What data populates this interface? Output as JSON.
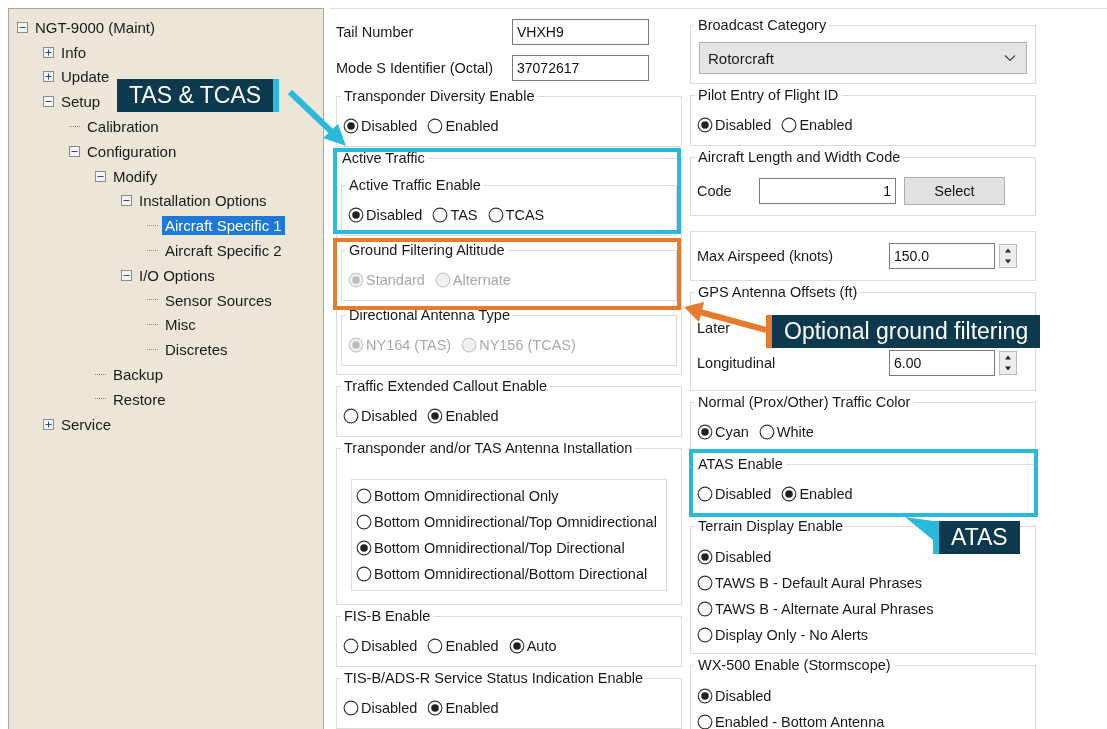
{
  "tree": [
    {
      "label": "NGT-9000 (Maint)",
      "expanded": true,
      "selected": false,
      "children": [
        {
          "label": "Info",
          "expanded": false,
          "selected": false
        },
        {
          "label": "Update",
          "expanded": false,
          "selected": false
        },
        {
          "label": "Setup",
          "expanded": true,
          "selected": false,
          "children": [
            {
              "label": "Calibration",
              "selected": false
            },
            {
              "label": "Configuration",
              "expanded": true,
              "selected": false,
              "children": [
                {
                  "label": "Modify",
                  "expanded": true,
                  "selected": false,
                  "children": [
                    {
                      "label": "Installation Options",
                      "expanded": true,
                      "selected": false,
                      "children": [
                        {
                          "label": "Aircraft Specific 1",
                          "selected": true
                        },
                        {
                          "label": "Aircraft Specific 2",
                          "selected": false
                        }
                      ]
                    },
                    {
                      "label": "I/O Options",
                      "expanded": true,
                      "selected": false,
                      "children": [
                        {
                          "label": "Sensor Sources",
                          "selected": false
                        },
                        {
                          "label": "Misc",
                          "selected": false
                        },
                        {
                          "label": "Discretes",
                          "selected": false
                        }
                      ]
                    }
                  ]
                },
                {
                  "label": "Backup",
                  "selected": false
                },
                {
                  "label": "Restore",
                  "selected": false
                }
              ]
            }
          ]
        },
        {
          "label": "Service",
          "expanded": false,
          "selected": false
        }
      ]
    }
  ],
  "column_1": [
    {
      "kind": "field",
      "label": "Tail Number",
      "value": "VHXH9"
    },
    {
      "kind": "field",
      "label": "Mode S Identifier (Octal)",
      "value": "37072617"
    },
    {
      "kind": "radio",
      "title": "Transponder Diversity Enable",
      "disabled": false,
      "options": [
        {
          "label": "Disabled",
          "selected": true
        },
        {
          "label": "Enabled",
          "selected": false
        }
      ]
    },
    {
      "kind": "section",
      "title": "Active Traffic",
      "groups": [
        {
          "kind": "radio",
          "title": "Active Traffic Enable",
          "disabled": false,
          "options": [
            {
              "label": "Disabled",
              "selected": true
            },
            {
              "label": "TAS",
              "selected": false
            },
            {
              "label": "TCAS",
              "selected": false
            }
          ]
        },
        {
          "kind": "radio",
          "title": "Ground Filtering Altitude",
          "disabled": true,
          "options": [
            {
              "label": "Standard",
              "selected": true
            },
            {
              "label": "Alternate",
              "selected": false
            }
          ]
        },
        {
          "kind": "radio",
          "title": "Directional Antenna Type",
          "disabled": true,
          "options": [
            {
              "label": "NY164 (TAS)",
              "selected": true
            },
            {
              "label": "NY156 (TCAS)",
              "selected": false
            }
          ]
        }
      ]
    },
    {
      "kind": "radio",
      "title": "Traffic Extended Callout Enable",
      "disabled": false,
      "options": [
        {
          "label": "Disabled",
          "selected": false
        },
        {
          "label": "Enabled",
          "selected": true
        }
      ]
    },
    {
      "kind": "radio_box",
      "title": "Transponder and/or TAS Antenna Installation",
      "disabled": false,
      "options": [
        {
          "label": "Bottom Omnidirectional Only",
          "selected": false
        },
        {
          "label": "Bottom Omnidirectional/Top Omnidirectional",
          "selected": false
        },
        {
          "label": "Bottom Omnidirectional/Top Directional",
          "selected": true
        },
        {
          "label": "Bottom Omnidirectional/Bottom Directional",
          "selected": false
        }
      ]
    },
    {
      "kind": "radio",
      "title": "FIS-B Enable",
      "disabled": false,
      "options": [
        {
          "label": "Disabled",
          "selected": false
        },
        {
          "label": "Enabled",
          "selected": false
        },
        {
          "label": "Auto",
          "selected": true
        }
      ]
    },
    {
      "kind": "radio",
      "title": "TIS-B/ADS-R Service Status Indication Enable",
      "disabled": false,
      "options": [
        {
          "label": "Disabled",
          "selected": false
        },
        {
          "label": "Enabled",
          "selected": true
        }
      ]
    }
  ],
  "column_2": [
    {
      "kind": "dropdown",
      "title": "Broadcast Category",
      "value": "Rotorcraft"
    },
    {
      "kind": "radio",
      "title": "Pilot Entry of Flight ID",
      "disabled": false,
      "options": [
        {
          "label": "Disabled",
          "selected": true
        },
        {
          "label": "Enabled",
          "selected": false
        }
      ]
    },
    {
      "kind": "code",
      "title": "Aircraft Length and Width Code",
      "label": "Code",
      "value": "1",
      "button": "Select"
    },
    {
      "kind": "spinner",
      "label": "Max Airspeed (knots)",
      "value": "150.0"
    },
    {
      "kind": "offsets",
      "title": "GPS Antenna Offsets (ft)",
      "rows": [
        {
          "label": "Later"
        },
        {
          "label": "Longitudinal",
          "value": "6.00"
        }
      ]
    },
    {
      "kind": "radio",
      "title": "Normal (Prox/Other) Traffic Color",
      "disabled": false,
      "options": [
        {
          "label": "Cyan",
          "selected": true
        },
        {
          "label": "White",
          "selected": false
        }
      ]
    },
    {
      "kind": "radio",
      "title": "ATAS Enable",
      "disabled": false,
      "options": [
        {
          "label": "Disabled",
          "selected": false
        },
        {
          "label": "Enabled",
          "selected": true
        }
      ]
    },
    {
      "kind": "radio_list",
      "title": "Terrain Display Enable",
      "disabled": false,
      "options": [
        {
          "label": "Disabled",
          "selected": true
        },
        {
          "label": "TAWS B - Default Aural Phrases",
          "selected": false
        },
        {
          "label": "TAWS B - Alternate Aural Phrases",
          "selected": false
        },
        {
          "label": "Display Only - No Alerts",
          "selected": false
        }
      ]
    },
    {
      "kind": "radio_list",
      "title": "WX-500 Enable (Stormscope)",
      "disabled": false,
      "options": [
        {
          "label": "Disabled",
          "selected": true
        },
        {
          "label": "Enabled - Bottom Antenna",
          "selected": false
        }
      ]
    }
  ],
  "annotations": [
    {
      "text": "TAS & TCAS",
      "color": "#2bb8dd"
    },
    {
      "text": "Optional ground filtering",
      "color": "#e87a2c"
    },
    {
      "text": "ATAS",
      "color": "#2bb8dd"
    }
  ]
}
